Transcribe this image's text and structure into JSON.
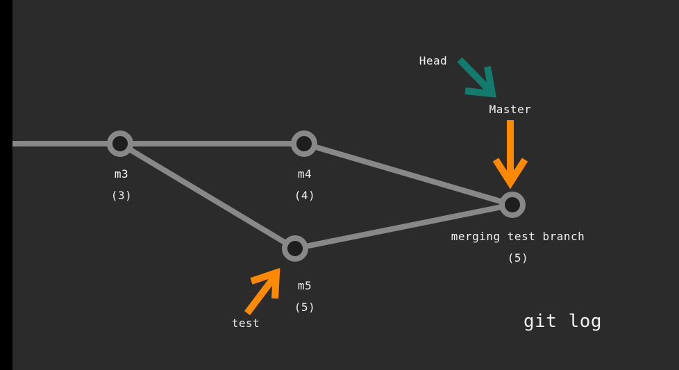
{
  "colors": {
    "background": "#2b2b2b",
    "edge": "#888888",
    "node_fill": "#1e1e1e",
    "head_arrow": "#137a6e",
    "branch_arrow": "#ff8a00",
    "text": "#f2f2f2"
  },
  "nodes": [
    {
      "id": "m3",
      "label": "m3",
      "number": "(3)"
    },
    {
      "id": "m4",
      "label": "m4",
      "number": "(4)"
    },
    {
      "id": "m5",
      "label": "m5",
      "number": "(5)"
    },
    {
      "id": "merge",
      "label": "merging test branch",
      "number": "(5)"
    }
  ],
  "edges": [
    [
      "start",
      "m3"
    ],
    [
      "m3",
      "m4"
    ],
    [
      "m3",
      "m5"
    ],
    [
      "m4",
      "merge"
    ],
    [
      "m5",
      "merge"
    ]
  ],
  "pointers": {
    "head": "Head",
    "master": "Master",
    "test": "test"
  },
  "caption": "git log"
}
